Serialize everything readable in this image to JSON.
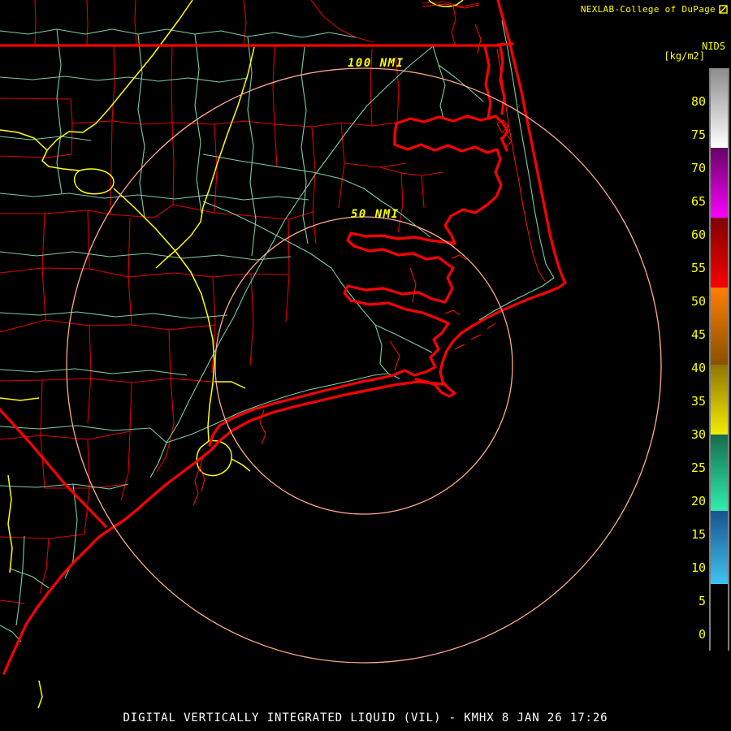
{
  "header": {
    "brand": "NEXLAB-College of DuPage"
  },
  "colorbar": {
    "title": "NIDS",
    "units": "[kg/m2]",
    "ticks": [
      80,
      75,
      70,
      65,
      60,
      55,
      50,
      45,
      40,
      35,
      30,
      25,
      20,
      15,
      10,
      5,
      0
    ],
    "value_min": -2.5,
    "value_max": 85,
    "bands": [
      {
        "v0": -2.5,
        "v1": 7.5,
        "bottom": "#000000",
        "top": "#000000"
      },
      {
        "v0": 7.5,
        "v1": 18.5,
        "bottom": "#3fc4f0",
        "top": "#17538f"
      },
      {
        "v0": 18.5,
        "v1": 30,
        "bottom": "#2eefaf",
        "top": "#156b4c"
      },
      {
        "v0": 30,
        "v1": 40.5,
        "bottom": "#f2ed00",
        "top": "#8f7500"
      },
      {
        "v0": 40.5,
        "v1": 52,
        "bottom": "#8a5000",
        "top": "#ff7f00"
      },
      {
        "v0": 52,
        "v1": 62.5,
        "bottom": "#fb0000",
        "top": "#7e0000"
      },
      {
        "v0": 62.5,
        "v1": 73,
        "bottom": "#fc00fc",
        "top": "#660066"
      },
      {
        "v0": 73,
        "v1": 85,
        "bottom": "#ffffff",
        "top": "#8c8c8c"
      }
    ]
  },
  "rings": [
    {
      "label": "100 NMI"
    },
    {
      "label": "50 NMI"
    }
  ],
  "footer": {
    "title": "DIGITAL VERTICALLY INTEGRATED LIQUID (VIL) - KMHX 8 JAN 26 17:26"
  },
  "colors": {
    "background": "#000000",
    "coastline": "#ff0000",
    "county_lines": "#df0000",
    "roads": "#7bcda0",
    "highways": "#ffff00",
    "range_rings": "#ffab8e",
    "annotation_text": "#ffff00",
    "title_text": "#ffffff"
  }
}
